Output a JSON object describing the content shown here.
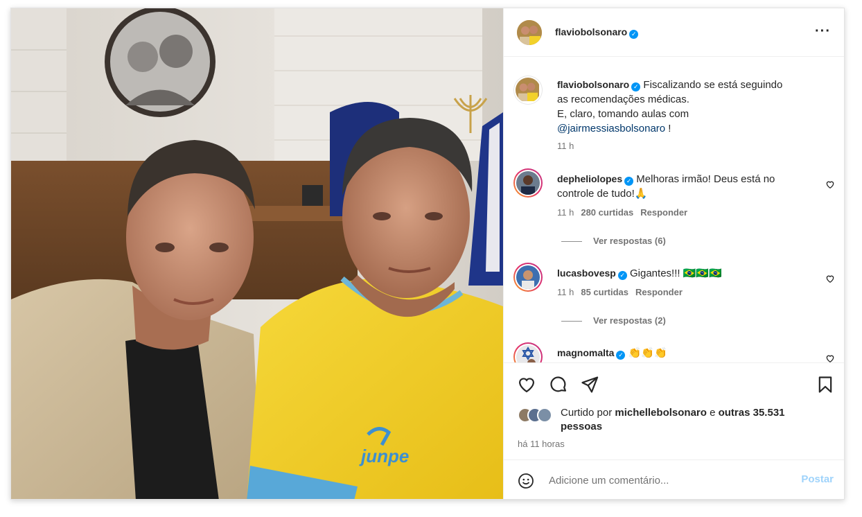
{
  "post": {
    "author": "flaviobolsonaro",
    "more_icon": "more-horizontal-icon",
    "caption": {
      "user": "flaviobolsonaro",
      "line1": "Fiscalizando se está seguindo",
      "line2": "as recomendações médicas.",
      "line3": "E, claro, tomando aulas com",
      "mention": "@jairmessiasbolsonaro",
      "after_mention": " !",
      "time": "11 h"
    },
    "comments": [
      {
        "user": "depheliolopes",
        "text_line1": "Melhoras irmão! Deus está no",
        "text_line2": "controle de tudo!🙏",
        "time": "11 h",
        "likes": "280 curtidas",
        "reply": "Responder",
        "view_replies": "Ver respostas (6)"
      },
      {
        "user": "lucasbovesp",
        "text_line1": "Gigantes!!! 🇧🇷🇧🇷🇧🇷",
        "time": "11 h",
        "likes": "85 curtidas",
        "reply": "Responder",
        "view_replies": "Ver respostas (2)"
      },
      {
        "user": "magnomalta",
        "text_line1": "👏👏👏"
      }
    ],
    "liked_by": {
      "prefix": "Curtido por",
      "user": "michellebolsonaro",
      "conj": "e",
      "others": "outras 35.531",
      "others_line2": "pessoas"
    },
    "posted_ago": "há 11 horas",
    "comment_box": {
      "placeholder": "Adicione um comentário...",
      "post_label": "Postar"
    }
  },
  "colors": {
    "verified": "#0095f6",
    "mention": "#00376b",
    "muted": "#737373",
    "post_button_disabled": "#9fd3fb",
    "shirt_yellow": "#f2d12a"
  }
}
